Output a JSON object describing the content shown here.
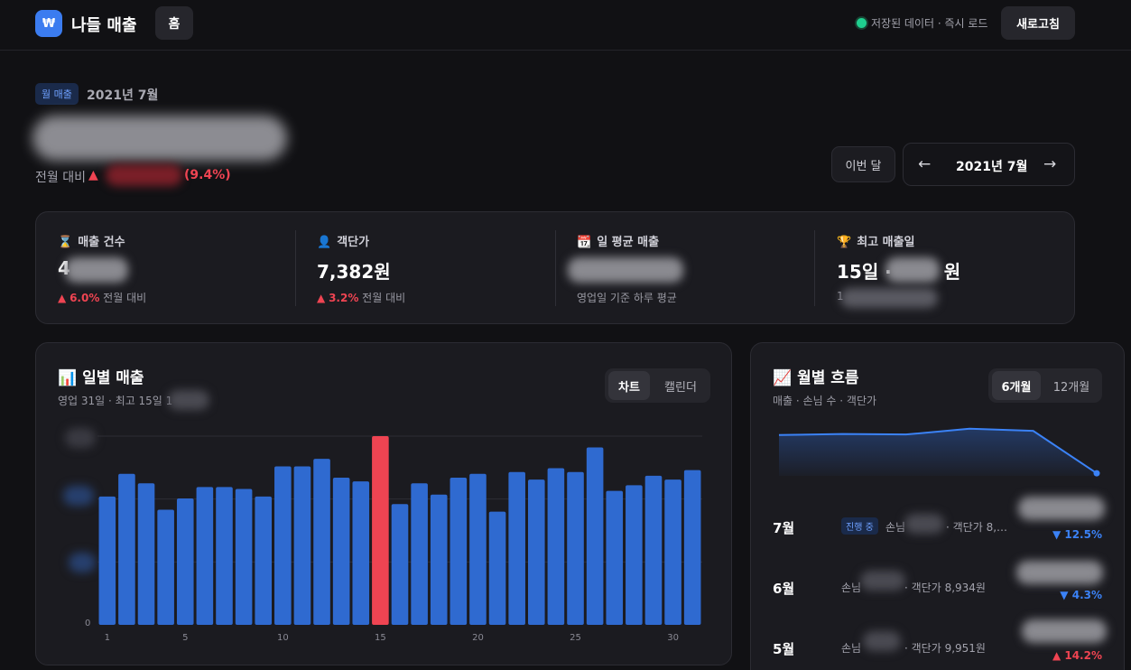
{
  "header": {
    "logo_icon": "₩",
    "app_title": "나들 매출",
    "home_label": "홈",
    "status_text": "저장된 데이터 · 즉시 로드",
    "refresh_label": "새로고침"
  },
  "summary": {
    "badge": "월 매출",
    "month": "2021년 7월",
    "mom_label": "전월 대비",
    "mom_arrow": "▲",
    "mom_pct": "(9.4%)",
    "this_month_label": "이번 달",
    "nav_prev": "←",
    "nav_label": "2021년 7월",
    "nav_next": "→"
  },
  "stats": [
    {
      "icon": "⌛",
      "title": "매출 건수",
      "value": "4",
      "sub_arrow": "▲",
      "sub_pct": "6.0%",
      "sub_text": "전월 대비"
    },
    {
      "icon": "👤",
      "title": "객단가",
      "value": "7,382원",
      "sub_arrow": "▲",
      "sub_pct": "3.2%",
      "sub_text": "전월 대비"
    },
    {
      "icon": "📆",
      "title": "일 평균 매출",
      "value": "",
      "sub_text": "영업일 기준 하루 평균"
    },
    {
      "icon": "🏆",
      "title": "최고 매출일",
      "value_prefix": "15일 ·",
      "value_suffix": "원",
      "sub_text": "1"
    }
  ],
  "daily": {
    "icon": "📊",
    "title": "일별 매출",
    "subtitle": "영업 31일 · 최고 15일 1",
    "tab_chart": "차트",
    "tab_calendar": "캘린더",
    "y_zero": "0"
  },
  "chart_data": {
    "type": "bar",
    "categories": [
      1,
      2,
      3,
      4,
      5,
      6,
      7,
      8,
      9,
      10,
      11,
      12,
      13,
      14,
      15,
      16,
      17,
      18,
      19,
      20,
      21,
      22,
      23,
      24,
      25,
      26,
      27,
      28,
      29,
      30,
      31
    ],
    "x_tick_labels": [
      "1",
      "5",
      "10",
      "15",
      "20",
      "25",
      "30"
    ],
    "values": [
      68,
      80,
      75,
      61,
      67,
      73,
      73,
      72,
      68,
      84,
      84,
      88,
      78,
      76,
      100,
      64,
      75,
      69,
      78,
      80,
      60,
      81,
      77,
      83,
      81,
      94,
      71,
      74,
      79,
      77,
      82
    ],
    "highlight_day": 15,
    "highlight_color": "#ef4452",
    "bar_color": "#2f6ad0",
    "ylim": [
      0,
      100
    ],
    "grid": true
  },
  "monthly": {
    "icon": "📈",
    "title": "월별 흐름",
    "subtitle": "매출 · 손님 수 · 객단가",
    "tab_6": "6개월",
    "tab_12": "12개월",
    "trend": [
      0.78,
      0.8,
      0.79,
      0.9,
      0.86,
      0.05
    ],
    "line_color": "#3b82f6",
    "rows": [
      {
        "name": "7월",
        "badge": "진행 중",
        "detail": "손님",
        "detail_tail": "· 객단가 8,…",
        "arrow": "▼",
        "pct": "12.5%",
        "dir": "down"
      },
      {
        "name": "6월",
        "detail": "손님",
        "detail_tail": "· 객단가 8,934원",
        "arrow": "▼",
        "pct": "4.3%",
        "dir": "down"
      },
      {
        "name": "5월",
        "detail": "손님",
        "detail_tail": "· 객단가 9,951원",
        "arrow": "▲",
        "pct": "14.2%",
        "dir": "up"
      }
    ]
  }
}
